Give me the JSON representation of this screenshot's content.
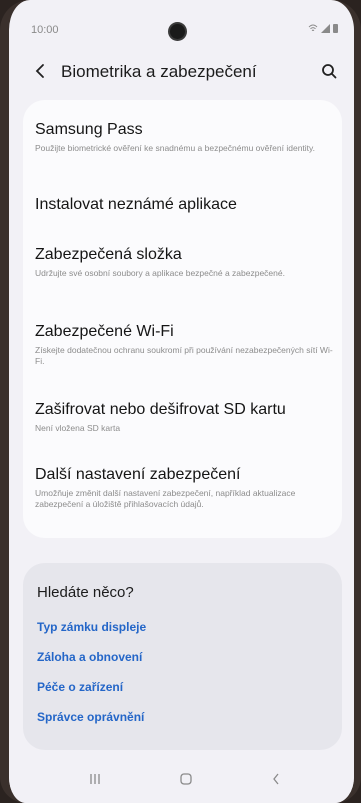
{
  "status_bar": {
    "time": "10:00",
    "icons_text": "⚡◢"
  },
  "header": {
    "title": "Biometrika a zabezpečení",
    "back_icon": "chevron-left-icon",
    "search_icon": "search-icon"
  },
  "menu": [
    {
      "title": "Samsung Pass",
      "subtitle": "Použijte biometrické ověření ke snadnému a bezpečnému ověření identity."
    },
    {
      "title": "Instalovat neznámé aplikace",
      "subtitle": ""
    },
    {
      "title": "Zabezpečená složka",
      "subtitle": "Udržujte své osobní soubory a aplikace bezpečné a zabezpečené."
    },
    {
      "title": "Zabezpečené Wi-Fi",
      "subtitle": "Získejte dodatečnou ochranu soukromí při používání nezabezpečených sítí Wi-Fi."
    },
    {
      "title": "Zašifrovat nebo dešifrovat SD kartu",
      "subtitle": "Není vložena SD karta"
    },
    {
      "title": "Další nastavení zabezpečení",
      "subtitle": "Umožňuje změnit další nastavení zabezpečení, například aktualizace zabezpečení a úložiště přihlašovacích údajů."
    }
  ],
  "suggestions": {
    "title": "Hledáte něco?",
    "links": [
      "Typ zámku displeje",
      "Záloha a obnovení",
      "Péče o zařízení",
      "Správce oprávnění"
    ]
  },
  "nav_bar": {
    "recents_icon": "recents-icon",
    "home_icon": "home-icon",
    "back_icon": "back-icon"
  },
  "colors": {
    "link": "#2466c8",
    "background": "#f2f1f6",
    "card": "#fbfbfd",
    "suggest_card": "#e6e6ec"
  }
}
